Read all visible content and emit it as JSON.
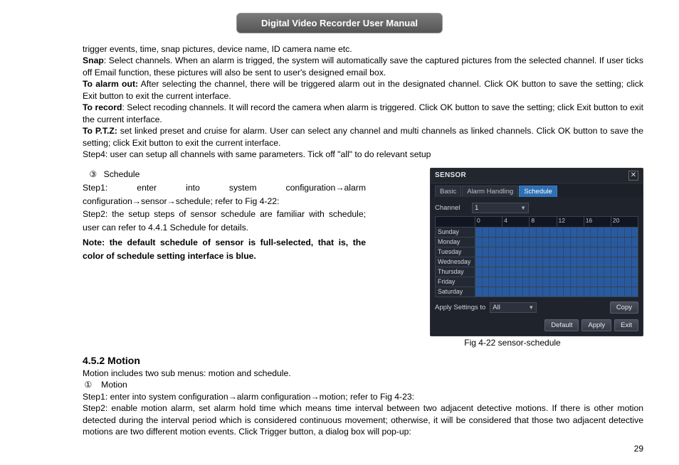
{
  "header": {
    "title": "Digital Video Recorder User Manual"
  },
  "body": {
    "para1_line1": "trigger events, time, snap pictures, device name, ID camera name etc.",
    "snap_label": "Snap",
    "snap_text": ": Select channels. When an alarm is trigged, the system will automatically save the captured pictures from the selected channel. If user ticks off Email function, these pictures will also be sent to user's designed email box.",
    "alarmout_label": "To alarm out:",
    "alarmout_text": " After selecting the channel, there will be triggered alarm out in the designated channel. Click OK button to save the setting; click Exit button to exit the current interface.",
    "record_label": "To record",
    "record_text": ": Select recoding channels. It will record the camera when alarm is triggered. Click OK button to save the setting; click Exit button to exit the current interface.",
    "ptz_label": "To P.T.Z:",
    "ptz_text": " set linked preset and cruise for alarm. User can select any channel and multi channels as linked channels. Click OK button to save the setting; click Exit button to exit the current interface.",
    "step4": "Step4: user can setup all channels with same parameters. Tick off \"all\" to do relevant setup"
  },
  "schedule": {
    "marker": "③",
    "title": "Schedule",
    "step1": "Step1: enter into system configuration→alarm configuration→sensor→schedule; refer to Fig 4-22:",
    "step2": "Step2: the setup steps of sensor schedule are familiar with schedule; user can refer to 4.4.1 Schedule for details.",
    "note": "Note: the default schedule of sensor is full-selected, that is, the color of schedule setting interface is blue."
  },
  "figure": {
    "window_title": "SENSOR",
    "tabs": [
      "Basic",
      "Alarm Handling",
      "Schedule"
    ],
    "active_tab": 2,
    "channel_label": "Channel",
    "channel_value": "1",
    "hours": [
      "0",
      "4",
      "8",
      "12",
      "16",
      "20"
    ],
    "days": [
      "Sunday",
      "Monday",
      "Tuesday",
      "Wednesday",
      "Thursday",
      "Friday",
      "Saturday"
    ],
    "apply_label": "Apply Settings to",
    "apply_value": "All",
    "copy_btn": "Copy",
    "buttons": [
      "Default",
      "Apply",
      "Exit"
    ],
    "caption": "Fig 4-22 sensor-schedule"
  },
  "motion": {
    "heading": "4.5.2  Motion",
    "intro": "Motion includes two sub menus: motion and schedule.",
    "marker": "①",
    "marker_label": "Motion",
    "step1": "Step1: enter into system configuration→alarm configuration→motion; refer to Fig 4-23:",
    "step2": "Step2: enable motion alarm, set alarm hold time which means time interval between two adjacent detective motions. If there is other motion detected during the interval period which is considered continuous movement; otherwise, it will be considered that those two adjacent detective motions are two different motion events. Click Trigger button, a dialog box will pop-up:"
  },
  "page_number": "29"
}
